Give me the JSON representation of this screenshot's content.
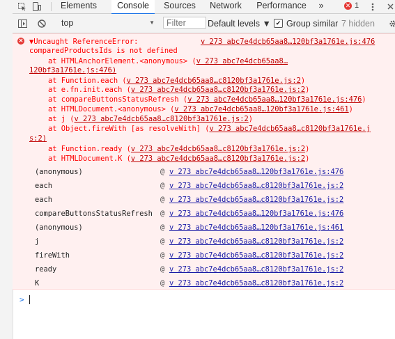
{
  "tabs": [
    {
      "label": "Elements",
      "active": false
    },
    {
      "label": "Console",
      "active": true
    },
    {
      "label": "Sources",
      "active": false
    },
    {
      "label": "Network",
      "active": false
    },
    {
      "label": "Performance",
      "active": false
    }
  ],
  "tabbar": {
    "more": "»",
    "error_count": "1",
    "error_badge": "✕"
  },
  "filterbar": {
    "context": "top",
    "filter_placeholder": "Filter",
    "levels": "Default levels ▼",
    "group_similar": "Group similar",
    "group_similar_checked": true,
    "hidden": "7 hidden"
  },
  "error": {
    "lines": [
      "Uncaught ReferenceError:",
      "comparedProductsIds is not defined",
      "at HTMLAnchorElement.<anonymous> (",
      "120bf3a1761e.js:476)",
      "at Function.each (",
      "at e.fn.init.each (",
      "at compareButtonsStatusRefresh (",
      "at HTMLDocument.<anonymous> (",
      "at j (",
      "at Object.fireWith [as resolveWith] (",
      "s:2)",
      "at Function.ready (",
      "at HTMLDocument.K ("
    ],
    "links": [
      "v 273 abc7e4dcb65aa8…120bf3a1761e.js:476",
      "v 273 abc7e4dcb65aa8…",
      "v 273 abc7e4dcb65aa8…c8120bf3a1761e.js:2",
      "v 273 abc7e4dcb65aa8…c8120bf3a1761e.js:2",
      "v 273 abc7e4dcb65aa8…120bf3a1761e.js:476",
      "v 273 abc7e4dcb65aa8…120bf3a1761e.js:461",
      "v 273 abc7e4dcb65aa8…c8120bf3a1761e.js:2",
      "v 273 abc7e4dcb65aa8…c8120bf3a1761e.j",
      "v 273 abc7e4dcb65aa8…c8120bf3a1761e.js:2",
      "v 273 abc7e4dcb65aa8…c8120bf3a1761e.js:2"
    ],
    "close": ")"
  },
  "stack": [
    {
      "fn": "(anonymous)",
      "link": "v 273 abc7e4dcb65aa8…120bf3a1761e.js:476"
    },
    {
      "fn": "each",
      "link": "v 273 abc7e4dcb65aa8…c8120bf3a1761e.js:2"
    },
    {
      "fn": "each",
      "link": "v 273 abc7e4dcb65aa8…c8120bf3a1761e.js:2"
    },
    {
      "fn": "compareButtonsStatusRefresh",
      "link": "v 273 abc7e4dcb65aa8…120bf3a1761e.js:476"
    },
    {
      "fn": "(anonymous)",
      "link": "v 273 abc7e4dcb65aa8…120bf3a1761e.js:461"
    },
    {
      "fn": "j",
      "link": "v 273 abc7e4dcb65aa8…c8120bf3a1761e.js:2"
    },
    {
      "fn": "fireWith",
      "link": "v 273 abc7e4dcb65aa8…c8120bf3a1761e.js:2"
    },
    {
      "fn": "ready",
      "link": "v 273 abc7e4dcb65aa8…c8120bf3a1761e.js:2"
    },
    {
      "fn": "K",
      "link": "v 273 abc7e4dcb65aa8…c8120bf3a1761e.js:2"
    }
  ],
  "stack_at": "@",
  "prompt": ">",
  "colors": {
    "error_text": "#fe0000",
    "error_bg": "#fff0f0",
    "link": "#1a1aa6",
    "accent": "#1a73e8",
    "badge": "#e53935"
  }
}
